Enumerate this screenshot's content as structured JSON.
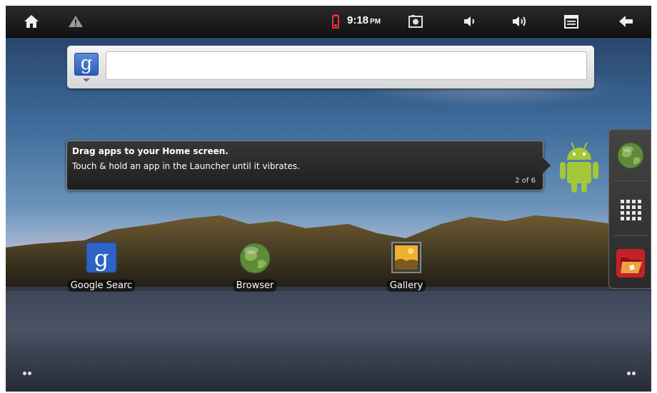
{
  "status_bar": {
    "icons": [
      "home-icon",
      "warning-icon",
      "battery-icon",
      "screenshot-icon",
      "volume-down-icon",
      "volume-up-icon",
      "menu-icon",
      "back-icon"
    ],
    "time": "9:18",
    "ampm": "PM"
  },
  "search": {
    "logo_letter": "g",
    "value": ""
  },
  "tip": {
    "title": "Drag apps to your Home screen.",
    "body": "Touch & hold an app in the Launcher until it vibrates.",
    "page": "2 of 6"
  },
  "apps": [
    {
      "label": "Google Searc",
      "icon": "google-search-icon"
    },
    {
      "label": "Browser",
      "icon": "browser-globe-icon"
    },
    {
      "label": "Gallery",
      "icon": "gallery-icon"
    }
  ],
  "dock": {
    "items": [
      "browser-globe-icon",
      "app-launcher-grid-icon",
      "folder-icon"
    ]
  },
  "colors": {
    "accent_green": "#a4c639",
    "statusbar_bg": "#1a1a1a"
  }
}
